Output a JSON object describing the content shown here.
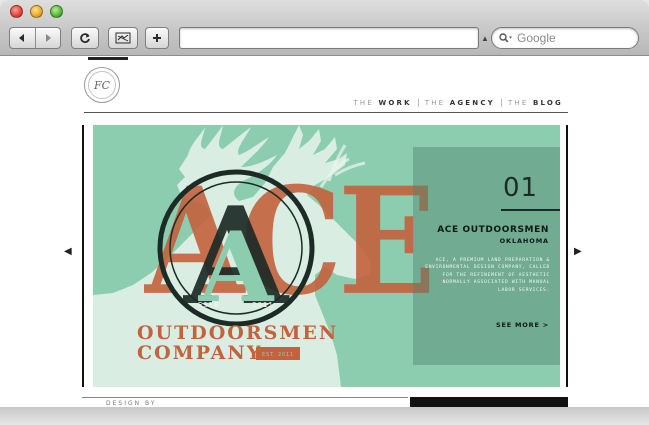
{
  "browser": {
    "url_value": "",
    "search_placeholder": "Google",
    "icons": [
      "back-icon",
      "forward-icon",
      "reload-icon",
      "snapback-icon",
      "add-bookmark-icon",
      "search-icon"
    ]
  },
  "site": {
    "logo_monogram": "FC",
    "nav": [
      {
        "prefix": "THE",
        "label": "WORK"
      },
      {
        "prefix": "THE",
        "label": "AGENCY"
      },
      {
        "prefix": "THE",
        "label": "BLOG"
      }
    ],
    "slide": {
      "number": "01",
      "client": "ACE OUTDOORSMEN",
      "location": "OKLAHOMA",
      "description": "ACE, a premium land preparation & environmental design company, called for the refinement of aesthetic normally associated with manual labor services.",
      "see_more": "SEE MORE >",
      "art": {
        "big_letters": "ACE",
        "emblem_letter": "A",
        "emblem_top": "ESTB",
        "emblem_year": "2011",
        "line1": "OUTDOORSMEN",
        "line2": "COMPANY",
        "tag": "EST. 2011"
      }
    },
    "bottom_text": "DESIGN BY",
    "colors": {
      "slide_bg": "#8ccdb0",
      "accent_orange": "#c4623c",
      "dark_green": "#1d2b27"
    }
  }
}
